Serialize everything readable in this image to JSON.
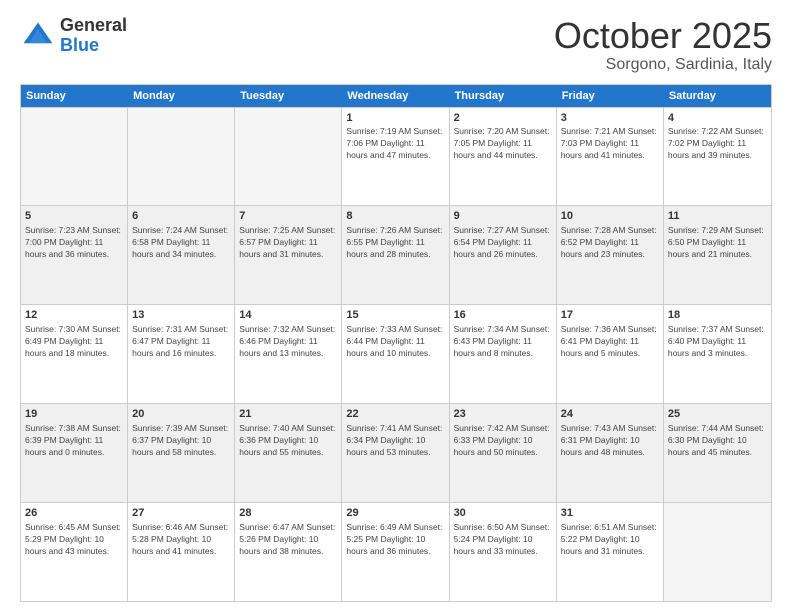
{
  "logo": {
    "general": "General",
    "blue": "Blue"
  },
  "title": "October 2025",
  "subtitle": "Sorgono, Sardinia, Italy",
  "header": {
    "days": [
      "Sunday",
      "Monday",
      "Tuesday",
      "Wednesday",
      "Thursday",
      "Friday",
      "Saturday"
    ]
  },
  "rows": [
    [
      {
        "day": "",
        "info": "",
        "empty": true
      },
      {
        "day": "",
        "info": "",
        "empty": true
      },
      {
        "day": "",
        "info": "",
        "empty": true
      },
      {
        "day": "1",
        "info": "Sunrise: 7:19 AM\nSunset: 7:06 PM\nDaylight: 11 hours\nand 47 minutes."
      },
      {
        "day": "2",
        "info": "Sunrise: 7:20 AM\nSunset: 7:05 PM\nDaylight: 11 hours\nand 44 minutes."
      },
      {
        "day": "3",
        "info": "Sunrise: 7:21 AM\nSunset: 7:03 PM\nDaylight: 11 hours\nand 41 minutes."
      },
      {
        "day": "4",
        "info": "Sunrise: 7:22 AM\nSunset: 7:02 PM\nDaylight: 11 hours\nand 39 minutes."
      }
    ],
    [
      {
        "day": "5",
        "info": "Sunrise: 7:23 AM\nSunset: 7:00 PM\nDaylight: 11 hours\nand 36 minutes.",
        "shaded": true
      },
      {
        "day": "6",
        "info": "Sunrise: 7:24 AM\nSunset: 6:58 PM\nDaylight: 11 hours\nand 34 minutes.",
        "shaded": true
      },
      {
        "day": "7",
        "info": "Sunrise: 7:25 AM\nSunset: 6:57 PM\nDaylight: 11 hours\nand 31 minutes.",
        "shaded": true
      },
      {
        "day": "8",
        "info": "Sunrise: 7:26 AM\nSunset: 6:55 PM\nDaylight: 11 hours\nand 28 minutes.",
        "shaded": true
      },
      {
        "day": "9",
        "info": "Sunrise: 7:27 AM\nSunset: 6:54 PM\nDaylight: 11 hours\nand 26 minutes.",
        "shaded": true
      },
      {
        "day": "10",
        "info": "Sunrise: 7:28 AM\nSunset: 6:52 PM\nDaylight: 11 hours\nand 23 minutes.",
        "shaded": true
      },
      {
        "day": "11",
        "info": "Sunrise: 7:29 AM\nSunset: 6:50 PM\nDaylight: 11 hours\nand 21 minutes.",
        "shaded": true
      }
    ],
    [
      {
        "day": "12",
        "info": "Sunrise: 7:30 AM\nSunset: 6:49 PM\nDaylight: 11 hours\nand 18 minutes."
      },
      {
        "day": "13",
        "info": "Sunrise: 7:31 AM\nSunset: 6:47 PM\nDaylight: 11 hours\nand 16 minutes."
      },
      {
        "day": "14",
        "info": "Sunrise: 7:32 AM\nSunset: 6:46 PM\nDaylight: 11 hours\nand 13 minutes."
      },
      {
        "day": "15",
        "info": "Sunrise: 7:33 AM\nSunset: 6:44 PM\nDaylight: 11 hours\nand 10 minutes."
      },
      {
        "day": "16",
        "info": "Sunrise: 7:34 AM\nSunset: 6:43 PM\nDaylight: 11 hours\nand 8 minutes."
      },
      {
        "day": "17",
        "info": "Sunrise: 7:36 AM\nSunset: 6:41 PM\nDaylight: 11 hours\nand 5 minutes."
      },
      {
        "day": "18",
        "info": "Sunrise: 7:37 AM\nSunset: 6:40 PM\nDaylight: 11 hours\nand 3 minutes."
      }
    ],
    [
      {
        "day": "19",
        "info": "Sunrise: 7:38 AM\nSunset: 6:39 PM\nDaylight: 11 hours\nand 0 minutes.",
        "shaded": true
      },
      {
        "day": "20",
        "info": "Sunrise: 7:39 AM\nSunset: 6:37 PM\nDaylight: 10 hours\nand 58 minutes.",
        "shaded": true
      },
      {
        "day": "21",
        "info": "Sunrise: 7:40 AM\nSunset: 6:36 PM\nDaylight: 10 hours\nand 55 minutes.",
        "shaded": true
      },
      {
        "day": "22",
        "info": "Sunrise: 7:41 AM\nSunset: 6:34 PM\nDaylight: 10 hours\nand 53 minutes.",
        "shaded": true
      },
      {
        "day": "23",
        "info": "Sunrise: 7:42 AM\nSunset: 6:33 PM\nDaylight: 10 hours\nand 50 minutes.",
        "shaded": true
      },
      {
        "day": "24",
        "info": "Sunrise: 7:43 AM\nSunset: 6:31 PM\nDaylight: 10 hours\nand 48 minutes.",
        "shaded": true
      },
      {
        "day": "25",
        "info": "Sunrise: 7:44 AM\nSunset: 6:30 PM\nDaylight: 10 hours\nand 45 minutes.",
        "shaded": true
      }
    ],
    [
      {
        "day": "26",
        "info": "Sunrise: 6:45 AM\nSunset: 5:29 PM\nDaylight: 10 hours\nand 43 minutes."
      },
      {
        "day": "27",
        "info": "Sunrise: 6:46 AM\nSunset: 5:28 PM\nDaylight: 10 hours\nand 41 minutes."
      },
      {
        "day": "28",
        "info": "Sunrise: 6:47 AM\nSunset: 5:26 PM\nDaylight: 10 hours\nand 38 minutes."
      },
      {
        "day": "29",
        "info": "Sunrise: 6:49 AM\nSunset: 5:25 PM\nDaylight: 10 hours\nand 36 minutes."
      },
      {
        "day": "30",
        "info": "Sunrise: 6:50 AM\nSunset: 5:24 PM\nDaylight: 10 hours\nand 33 minutes."
      },
      {
        "day": "31",
        "info": "Sunrise: 6:51 AM\nSunset: 5:22 PM\nDaylight: 10 hours\nand 31 minutes."
      },
      {
        "day": "",
        "info": "",
        "empty": true
      }
    ]
  ]
}
